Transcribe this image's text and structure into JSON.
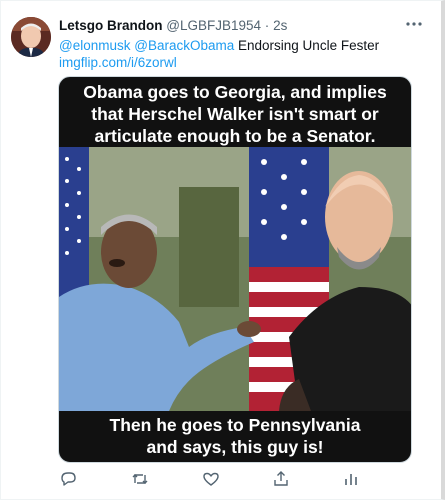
{
  "tweet": {
    "display_name": "Letsgo Brandon",
    "handle": "@LGBFJB1954",
    "separator": "·",
    "timestamp": "2s",
    "mention_1": "@elonmusk",
    "mention_2": "@BarackObama",
    "text": "Endorsing Uncle Fester",
    "link": "imgflip.com/i/6zorwl"
  },
  "meme": {
    "top_line_1": "Obama goes to Georgia, and implies",
    "top_line_2": "that Herschel Walker isn't smart or",
    "top_line_3": "articulate enough to be a Senator.",
    "bottom_line_1": "Then he goes to Pennsylvania",
    "bottom_line_2": "and says, this guy is!"
  },
  "colors": {
    "accent": "#1d9bf0",
    "secondary_text": "#536471",
    "icon": "#536471"
  }
}
